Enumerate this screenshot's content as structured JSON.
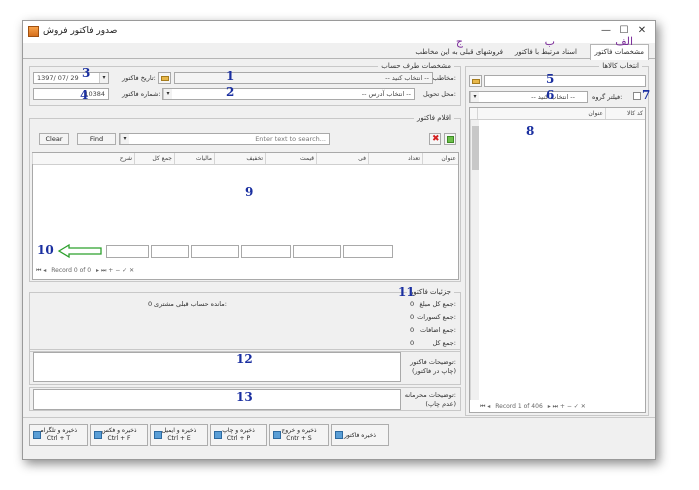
{
  "window": {
    "title": "صدور فاکتور فروش",
    "close_glyph": "✕",
    "maximize_glyph": "☐",
    "minimize_glyph": "—"
  },
  "tabs": [
    {
      "label": "مشخصات فاکتور",
      "letter": "الف"
    },
    {
      "label": "اسناد مرتبط با فاکتور",
      "letter": "ب"
    },
    {
      "label": "فروشهای قبلی به این مخاطب",
      "letter": "ج"
    }
  ],
  "goods": {
    "group_title": "انتخاب کالاها",
    "group_filter_label": "فیلتر گروه:",
    "group_select": "-- انتخاب کنید --",
    "grid_cols": [
      "کد کالا",
      "عنوان"
    ],
    "nav": "Record 1 of 406",
    "ann_5": "5",
    "ann_6": "6",
    "ann_7": "7",
    "ann_8": "8"
  },
  "party": {
    "group_title": "مشخصات طرف حساب",
    "contact_label": "مخاطب:",
    "contact_select": "-- انتخاب کنید --",
    "delivery_label": "محل تحویل:",
    "delivery_select": "-- انتخاب آدرس --",
    "date_label": "تاریخ فاکتور:",
    "date_value": "1397/ 07/ 29",
    "number_label": "شماره فاکتور:",
    "number_value": "10384",
    "ann_1": "1",
    "ann_2": "2",
    "ann_3": "3",
    "ann_4": "4"
  },
  "items": {
    "group_title": "اقلام فاکتور",
    "search_placeholder": "Enter text to search...",
    "find_label": "Find",
    "clear_label": "Clear",
    "cols": [
      "عنوان",
      "تعداد",
      "فی",
      "قیمت",
      "تخفیف",
      "مالیات",
      "جمع کل",
      "شرح"
    ],
    "nav": "Record 0 of 0",
    "ann_9": "9",
    "ann_10": "10"
  },
  "details": {
    "group_title": "جزئیات فاکتور",
    "rows": [
      {
        "label": "جمع کل مبلغ:",
        "value": "0"
      },
      {
        "label": "جمع کسورات:",
        "value": "0"
      },
      {
        "label": "جمع اضافات:",
        "value": "0"
      },
      {
        "label": "جمع کل:",
        "value": "0"
      }
    ],
    "balance_label": "مانده حساب قبلی مشتری:",
    "balance_value": "0",
    "ann_11": "11"
  },
  "notes": {
    "print_label": "توضیحات فاکتور:",
    "print_sub": "(چاپ در فاکتور)",
    "private_label": "توضیحات محرمانه:",
    "private_sub": "(عدم چاپ)",
    "ann_12": "12",
    "ann_13": "13"
  },
  "actions": {
    "save": "ذخیره فاکتور",
    "save_exit": "ذخیره و خروج",
    "save_exit_key": "Cntr + S",
    "save_print": "ذخیره و چاپ",
    "save_print_key": "Ctrl + P",
    "save_email": "ذخیره و ایمیل",
    "save_email_key": "Ctrl + E",
    "save_fax": "ذخیره و فکس",
    "save_fax_key": "Ctrl + F",
    "save_telegram": "ذخیره و تلگرام",
    "save_telegram_key": "Ctrl + T"
  },
  "colors": {
    "annotation": "#1a2fa0",
    "tab_letter": "#7a2a9a",
    "arrow": "#2ca02c"
  }
}
